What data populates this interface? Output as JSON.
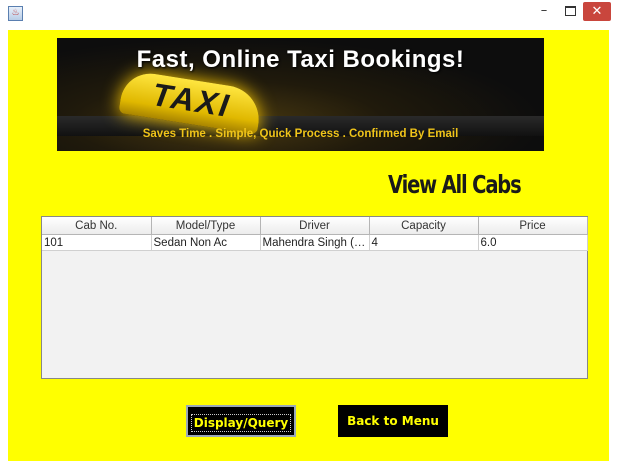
{
  "window": {
    "title": ""
  },
  "banner": {
    "title": "Fast, Online Taxi Bookings!",
    "sign_text": "TAXI",
    "subtitle": "Saves Time . Simple, Quick Process . Confirmed By Email"
  },
  "page": {
    "heading": "View All Cabs"
  },
  "table": {
    "columns": [
      "Cab No.",
      "Model/Type",
      "Driver",
      "Capacity",
      "Price"
    ],
    "rows": [
      [
        "101",
        "Sedan Non Ac",
        "Mahendra Singh (A...",
        "4",
        "6.0"
      ]
    ]
  },
  "buttons": {
    "display_query": "Display/Query",
    "back_to_menu": "Back to Menu"
  },
  "colors": {
    "background": "#ffff00",
    "button_bg": "#000000",
    "button_text": "#ffff00",
    "close": "#c9463d"
  }
}
